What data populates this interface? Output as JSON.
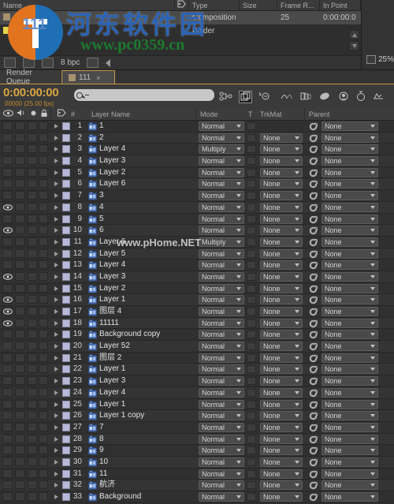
{
  "app": {
    "zoom_level": "25%"
  },
  "project_panel": {
    "columns": [
      "Name",
      "tag-icon",
      "Type",
      "Size",
      "Frame R...",
      "In Point"
    ],
    "rows": [
      {
        "name": "111",
        "swatch": "comp",
        "type": "Composition",
        "size": "",
        "frame_rate": "25",
        "in_point": "0:00:00:0",
        "selected": true
      },
      {
        "name": "Layers",
        "swatch": "folder",
        "type": "Folder",
        "size": "",
        "frame_rate": "",
        "in_point": "",
        "selected": false
      }
    ],
    "toolbar": {
      "bit_depth": "8 bpc",
      "icons": [
        "new-comp-icon",
        "new-folder-icon",
        "project-settings-icon",
        "delete-icon",
        "collapse-arrow-icon"
      ]
    }
  },
  "timeline": {
    "tabs": [
      {
        "label": "Render Queue",
        "active": false,
        "closeable": false
      },
      {
        "label": "111",
        "active": true,
        "closeable": true,
        "close_label": "×"
      }
    ],
    "timecode": "0:00:00:00",
    "frame_info": "00000 (25.00 fps)",
    "search_placeholder": "",
    "search_value": "",
    "toolbar_icons": [
      "composition-mini-flowchart-icon",
      "draft-3d-icon",
      "hide-shy-layers-icon",
      "frame-blending-icon",
      "motion-blur-icon",
      "brainstorm-icon",
      "graph-editor-icon",
      "auto-keyframe-icon"
    ],
    "columns": {
      "video": "eye-icon",
      "audio": "speaker-icon",
      "solo": "solo-icon",
      "lock": "lock-icon",
      "label": "label-tag-icon",
      "number": "#",
      "layer_name": "Layer Name",
      "mode": "Mode",
      "t": "T",
      "trkmat": "TrkMat",
      "parent": "Parent"
    },
    "layers": [
      {
        "num": "1",
        "name": "1",
        "visible": false,
        "mode": "Normal",
        "trkmat": "",
        "parent": "None"
      },
      {
        "num": "2",
        "name": "2",
        "visible": false,
        "mode": "Normal",
        "trkmat": "None",
        "parent": "None"
      },
      {
        "num": "3",
        "name": "Layer 4",
        "visible": false,
        "mode": "Multiply",
        "trkmat": "None",
        "parent": "None"
      },
      {
        "num": "4",
        "name": "Layer 3",
        "visible": false,
        "mode": "Normal",
        "trkmat": "None",
        "parent": "None"
      },
      {
        "num": "5",
        "name": "Layer 2",
        "visible": false,
        "mode": "Normal",
        "trkmat": "None",
        "parent": "None"
      },
      {
        "num": "6",
        "name": "Layer 6",
        "visible": false,
        "mode": "Normal",
        "trkmat": "None",
        "parent": "None"
      },
      {
        "num": "7",
        "name": "3",
        "visible": false,
        "mode": "Normal",
        "trkmat": "None",
        "parent": "None"
      },
      {
        "num": "8",
        "name": "4",
        "visible": true,
        "mode": "Normal",
        "trkmat": "None",
        "parent": "None"
      },
      {
        "num": "9",
        "name": "5",
        "visible": false,
        "mode": "Normal",
        "trkmat": "None",
        "parent": "None"
      },
      {
        "num": "10",
        "name": "6",
        "visible": true,
        "mode": "Normal",
        "trkmat": "None",
        "parent": "None"
      },
      {
        "num": "11",
        "name": "Layer 6",
        "visible": false,
        "mode": "Multiply",
        "trkmat": "None",
        "parent": "None"
      },
      {
        "num": "12",
        "name": "Layer 5",
        "visible": false,
        "mode": "Normal",
        "trkmat": "None",
        "parent": "None"
      },
      {
        "num": "13",
        "name": "Layer 4",
        "visible": false,
        "mode": "Normal",
        "trkmat": "None",
        "parent": "None"
      },
      {
        "num": "14",
        "name": "Layer 3",
        "visible": true,
        "mode": "Normal",
        "trkmat": "None",
        "parent": "None"
      },
      {
        "num": "15",
        "name": "Layer 2",
        "visible": false,
        "mode": "Normal",
        "trkmat": "None",
        "parent": "None"
      },
      {
        "num": "16",
        "name": "Layer 1",
        "visible": true,
        "mode": "Normal",
        "trkmat": "None",
        "parent": "None"
      },
      {
        "num": "17",
        "name": "图层 4",
        "visible": true,
        "mode": "Normal",
        "trkmat": "None",
        "parent": "None"
      },
      {
        "num": "18",
        "name": "11111",
        "visible": true,
        "mode": "Normal",
        "trkmat": "None",
        "parent": "None"
      },
      {
        "num": "19",
        "name": "Background copy",
        "visible": false,
        "mode": "Normal",
        "trkmat": "None",
        "parent": "None"
      },
      {
        "num": "20",
        "name": "Layer 52",
        "visible": false,
        "mode": "Normal",
        "trkmat": "None",
        "parent": "None"
      },
      {
        "num": "21",
        "name": "图层 2",
        "visible": false,
        "mode": "Normal",
        "trkmat": "None",
        "parent": "None"
      },
      {
        "num": "22",
        "name": "Layer 1",
        "visible": false,
        "mode": "Normal",
        "trkmat": "None",
        "parent": "None"
      },
      {
        "num": "23",
        "name": "Layer 3",
        "visible": false,
        "mode": "Normal",
        "trkmat": "None",
        "parent": "None"
      },
      {
        "num": "24",
        "name": "Layer 4",
        "visible": false,
        "mode": "Normal",
        "trkmat": "None",
        "parent": "None"
      },
      {
        "num": "25",
        "name": "Layer 1",
        "visible": false,
        "mode": "Normal",
        "trkmat": "None",
        "parent": "None"
      },
      {
        "num": "26",
        "name": "Layer 1 copy",
        "visible": false,
        "mode": "Normal",
        "trkmat": "None",
        "parent": "None"
      },
      {
        "num": "27",
        "name": "7",
        "visible": false,
        "mode": "Normal",
        "trkmat": "None",
        "parent": "None"
      },
      {
        "num": "28",
        "name": "8",
        "visible": false,
        "mode": "Normal",
        "trkmat": "None",
        "parent": "None"
      },
      {
        "num": "29",
        "name": "9",
        "visible": false,
        "mode": "Normal",
        "trkmat": "None",
        "parent": "None"
      },
      {
        "num": "30",
        "name": "10",
        "visible": false,
        "mode": "Normal",
        "trkmat": "None",
        "parent": "None"
      },
      {
        "num": "31",
        "name": "11",
        "visible": false,
        "mode": "Normal",
        "trkmat": "None",
        "parent": "None"
      },
      {
        "num": "32",
        "name": "航济",
        "visible": false,
        "mode": "Normal",
        "trkmat": "None",
        "parent": "None"
      },
      {
        "num": "33",
        "name": "Background",
        "visible": false,
        "mode": "Normal",
        "trkmat": "None",
        "parent": "None"
      }
    ]
  },
  "watermarks": {
    "site_cn": "河东软件园",
    "site_url": "www.pc0359.cn",
    "mid_text": "www.pHome.NET",
    "logo_text": "111"
  },
  "colors": {
    "accent_orange": "#c59a4a",
    "timecode": "#d9a441",
    "panel_bg": "#2e2e2e",
    "row_bg": "#343434",
    "label_swatch": "#b8b8d8"
  }
}
